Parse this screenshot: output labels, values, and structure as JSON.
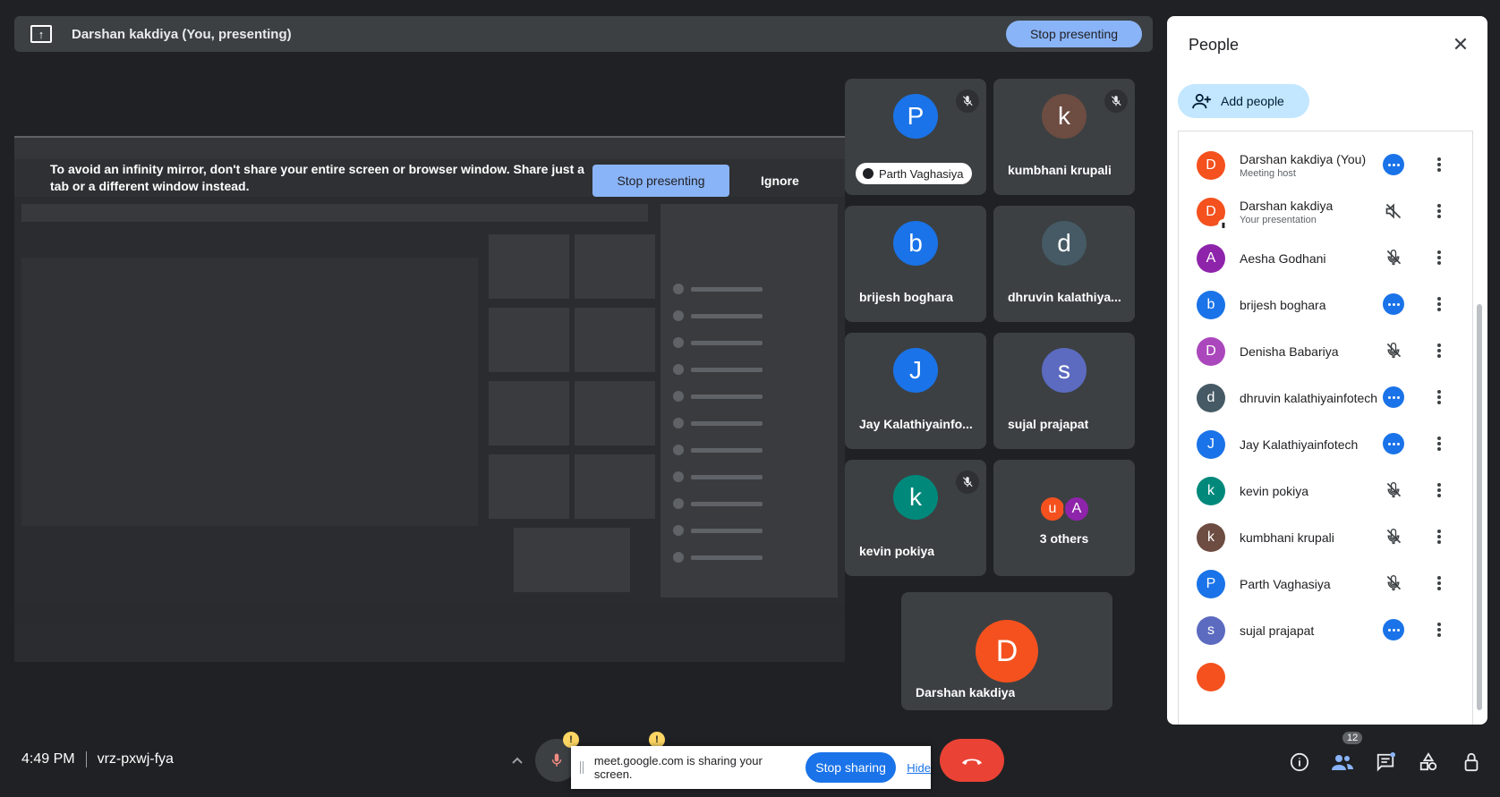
{
  "present_bar": {
    "title": "Darshan kakdiya (You, presenting)",
    "stop_label": "Stop presenting"
  },
  "shared_screen": {
    "warning": "To avoid an infinity mirror, don't share your entire screen or browser window. Share just a tab or a different window instead.",
    "stop_label": "Stop presenting",
    "ignore_label": "Ignore"
  },
  "tiles": [
    {
      "name": "Parth Vaghasiya",
      "initial": "P",
      "color": "#1a73e8"
    },
    {
      "name": "kumbhani krupali",
      "initial": "k",
      "color": "#6d4c41"
    },
    {
      "name": "brijesh boghara",
      "initial": "b",
      "color": "#1a73e8"
    },
    {
      "name": "dhruvin kalathiya...",
      "initial": "d",
      "color": "#455a64"
    },
    {
      "name": "Jay Kalathiyainfo...",
      "initial": "J",
      "color": "#1a73e8"
    },
    {
      "name": "sujal prajapat",
      "initial": "s",
      "color": "#5c6bc0"
    },
    {
      "name": "kevin pokiya",
      "initial": "k",
      "color": "#00897b"
    },
    {
      "name": "3 others",
      "initial": "",
      "color": ""
    },
    {
      "name": "Darshan kakdiya",
      "initial": "D",
      "color": "#f4511e"
    }
  ],
  "others": {
    "a1": "u",
    "a2": "A"
  },
  "people_panel": {
    "title": "People",
    "add_label": "Add people",
    "rows": [
      {
        "name": "Darshan kakdiya (You)",
        "sub": "Meeting host",
        "initial": "D",
        "color": "#f4511e"
      },
      {
        "name": "Darshan kakdiya",
        "sub": "Your presentation",
        "initial": "D",
        "color": "#f4511e"
      },
      {
        "name": "Aesha Godhani",
        "sub": "",
        "initial": "A",
        "color": "#8e24aa"
      },
      {
        "name": "brijesh boghara",
        "sub": "",
        "initial": "b",
        "color": "#1a73e8"
      },
      {
        "name": "Denisha Babariya",
        "sub": "",
        "initial": "D",
        "color": "#ab47bc"
      },
      {
        "name": "dhruvin kalathiyainfotech",
        "sub": "",
        "initial": "d",
        "color": "#455a64"
      },
      {
        "name": "Jay Kalathiyainfotech",
        "sub": "",
        "initial": "J",
        "color": "#1a73e8"
      },
      {
        "name": "kevin pokiya",
        "sub": "",
        "initial": "k",
        "color": "#00897b"
      },
      {
        "name": "kumbhani krupali",
        "sub": "",
        "initial": "k",
        "color": "#6d4c41"
      },
      {
        "name": "Parth Vaghasiya",
        "sub": "",
        "initial": "P",
        "color": "#1a73e8"
      },
      {
        "name": "sujal prajapat",
        "sub": "",
        "initial": "s",
        "color": "#5c6bc0"
      }
    ]
  },
  "bottom_bar": {
    "time": "4:49 PM",
    "meeting_code": "vrz-pxwj-fya",
    "people_count": "12"
  },
  "share_notice": {
    "text": "meet.google.com is sharing your screen.",
    "stop_label": "Stop sharing",
    "hide_label": "Hide"
  }
}
